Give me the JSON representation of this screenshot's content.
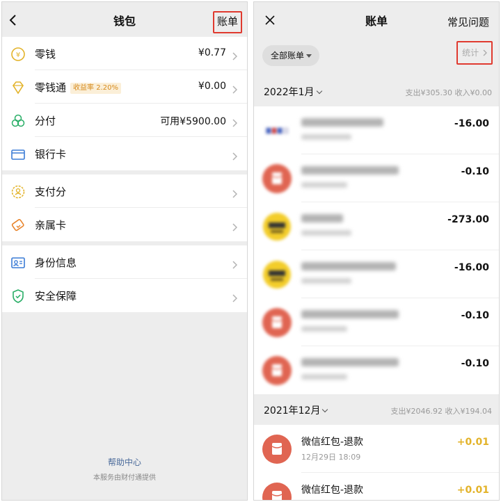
{
  "wallet": {
    "title": "钱包",
    "bill_button": "账单",
    "groups": [
      [
        {
          "label": "零钱",
          "value": "¥0.77",
          "icon": "coin-icon"
        },
        {
          "label": "零钱通",
          "badge": "收益率 2.20%",
          "value": "¥0.00",
          "icon": "diamond-icon"
        },
        {
          "label": "分付",
          "value": "可用¥5900.00",
          "icon": "clover-icon"
        },
        {
          "label": "银行卡",
          "value": "",
          "icon": "bank-card-icon"
        }
      ],
      [
        {
          "label": "支付分",
          "value": "",
          "icon": "credit-score-icon"
        },
        {
          "label": "亲属卡",
          "value": "",
          "icon": "family-card-icon"
        }
      ],
      [
        {
          "label": "身份信息",
          "value": "",
          "icon": "id-card-icon"
        },
        {
          "label": "安全保障",
          "value": "",
          "icon": "shield-icon"
        }
      ]
    ],
    "help_center": "帮助中心",
    "provider_note": "本服务由财付通提供"
  },
  "bill": {
    "title": "账单",
    "faq": "常见问题",
    "filter": "全部账单",
    "stats": "统计",
    "months": [
      {
        "label": "2022年1月",
        "summary": "支出¥305.30  收入¥0.00",
        "items": [
          {
            "amount": "-16.00",
            "avatar": "bank-logo-icon",
            "blurred": true
          },
          {
            "amount": "-0.10",
            "avatar": "red-packet-icon",
            "blurred": true
          },
          {
            "amount": "-273.00",
            "avatar": "merchant-yellow-icon",
            "blurred": true
          },
          {
            "amount": "-16.00",
            "avatar": "merchant-yellow-icon",
            "blurred": true
          },
          {
            "amount": "-0.10",
            "avatar": "red-packet-icon",
            "blurred": true
          },
          {
            "amount": "-0.10",
            "avatar": "red-packet-icon",
            "blurred": true
          }
        ]
      },
      {
        "label": "2021年12月",
        "summary": "支出¥2046.92  收入¥194.04",
        "items": [
          {
            "name": "微信红包-退款",
            "date": "12月29日 18:09",
            "amount": "+0.01",
            "avatar": "red-packet-icon"
          },
          {
            "name": "微信红包-退款",
            "date": "",
            "amount": "+0.01",
            "avatar": "red-packet-icon"
          }
        ]
      }
    ]
  },
  "colors": {
    "accent": "#e03a2f",
    "income": "#e3b32a",
    "link": "#4a6a9a",
    "badge": "#d68a1c"
  }
}
